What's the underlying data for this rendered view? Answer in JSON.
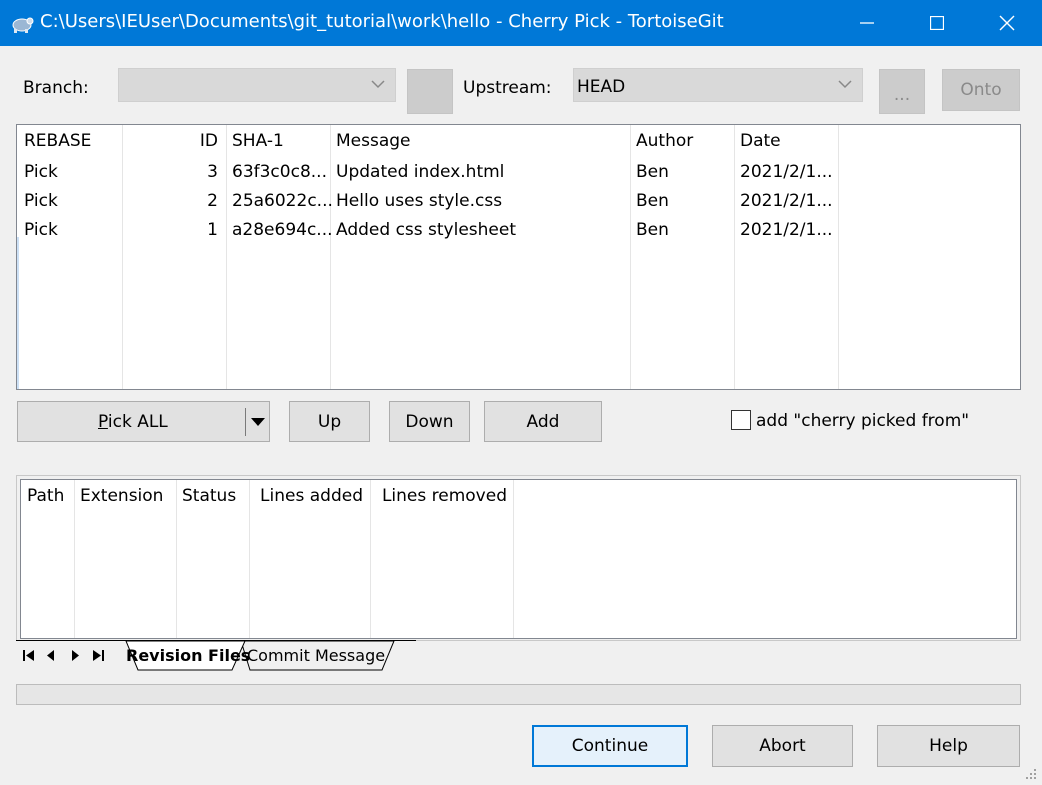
{
  "window": {
    "title": "C:\\Users\\IEUser\\Documents\\git_tutorial\\work\\hello - Cherry Pick - TortoiseGit",
    "controls": [
      "minimize-icon",
      "maximize-icon",
      "close-icon"
    ]
  },
  "branch": {
    "label": "Branch:",
    "value": ""
  },
  "upstream": {
    "label": "Upstream:",
    "value": "HEAD"
  },
  "browse_label": "...",
  "onto_label": "Onto",
  "commits": {
    "columns": [
      "REBASE",
      "ID",
      "SHA-1",
      "Message",
      "Author",
      "Date"
    ],
    "rows": [
      {
        "action": "Pick",
        "id": "3",
        "sha": "63f3c0c8...",
        "message": "Updated index.html",
        "author": "Ben",
        "date": "2021/2/1..."
      },
      {
        "action": "Pick",
        "id": "2",
        "sha": "25a6022c...",
        "message": "Hello uses style.css",
        "author": "Ben",
        "date": "2021/2/1..."
      },
      {
        "action": "Pick",
        "id": "1",
        "sha": "a28e694c...",
        "message": "Added css stylesheet",
        "author": "Ben",
        "date": "2021/2/1..."
      }
    ]
  },
  "actions": {
    "pick_all_prefix": "P",
    "pick_all_rest": "ick ALL",
    "up": "Up",
    "down": "Down",
    "add": "Add",
    "cherry_picked_from_label": "add \"cherry picked from\"",
    "cherry_picked_from_checked": false
  },
  "files": {
    "columns": [
      "Path",
      "Extension",
      "Status",
      "Lines added",
      "Lines removed"
    ]
  },
  "tabs": [
    {
      "label": "Revision Files",
      "active": true
    },
    {
      "label": "Commit Message",
      "active": false
    }
  ],
  "progress": {
    "value": 0
  },
  "footer": {
    "continue": "Continue",
    "abort": "Abort",
    "help": "Help"
  }
}
